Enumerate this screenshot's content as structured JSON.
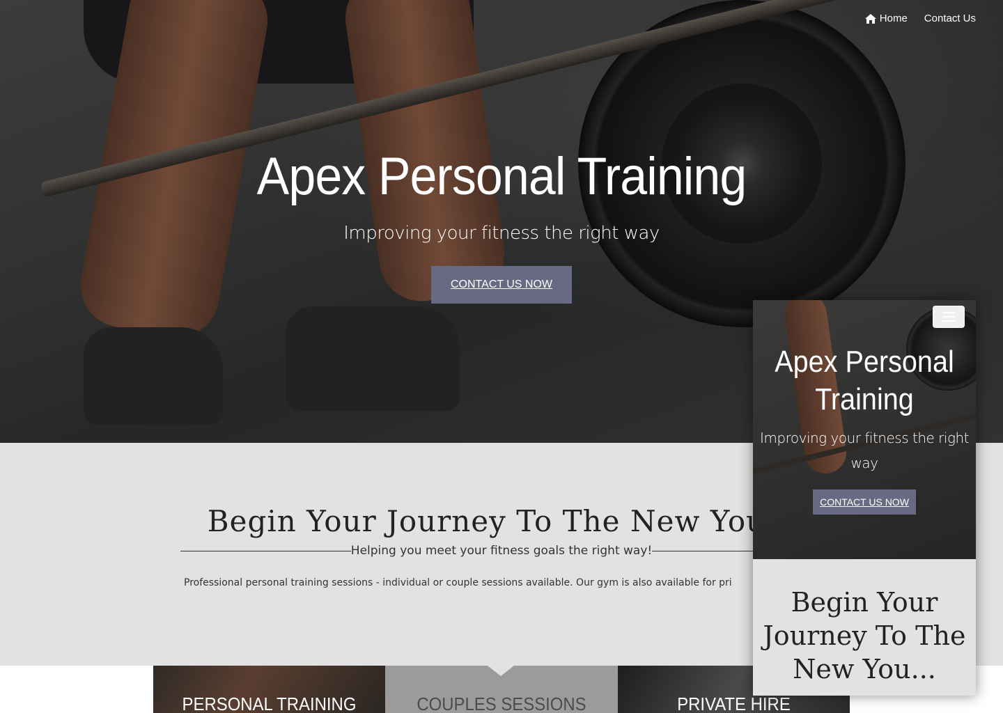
{
  "nav": {
    "home_label": "Home",
    "contact_label": "Contact Us"
  },
  "hero": {
    "title": "Apex Personal Training",
    "subtitle": "Improving your fitness the right way",
    "cta_label": "CONTACT US NOW"
  },
  "intro": {
    "title": "Begin Your Journey To The New You...",
    "tagline": "Helping you meet your fitness goals the right way!",
    "body": "Professional personal training sessions - individual or couple sessions available. Our gym is also available for pri"
  },
  "services": [
    {
      "label": "PERSONAL TRAINING"
    },
    {
      "label": "COUPLES SESSIONS"
    },
    {
      "label": "PRIVATE HIRE"
    }
  ],
  "mobile": {
    "title": "Apex Personal Training",
    "subtitle": "Improving your fitness the right way",
    "cta_label": "CONTACT US NOW",
    "intro_title": "Begin Your Journey To The New You..."
  },
  "colors": {
    "accent": "#676a82",
    "section_bg": "#e2e2e2",
    "active_service_bg": "#9b9b9b"
  },
  "icons": {
    "home": "home-icon",
    "menu": "hamburger-menu-icon",
    "caret": "caret-down-icon"
  }
}
